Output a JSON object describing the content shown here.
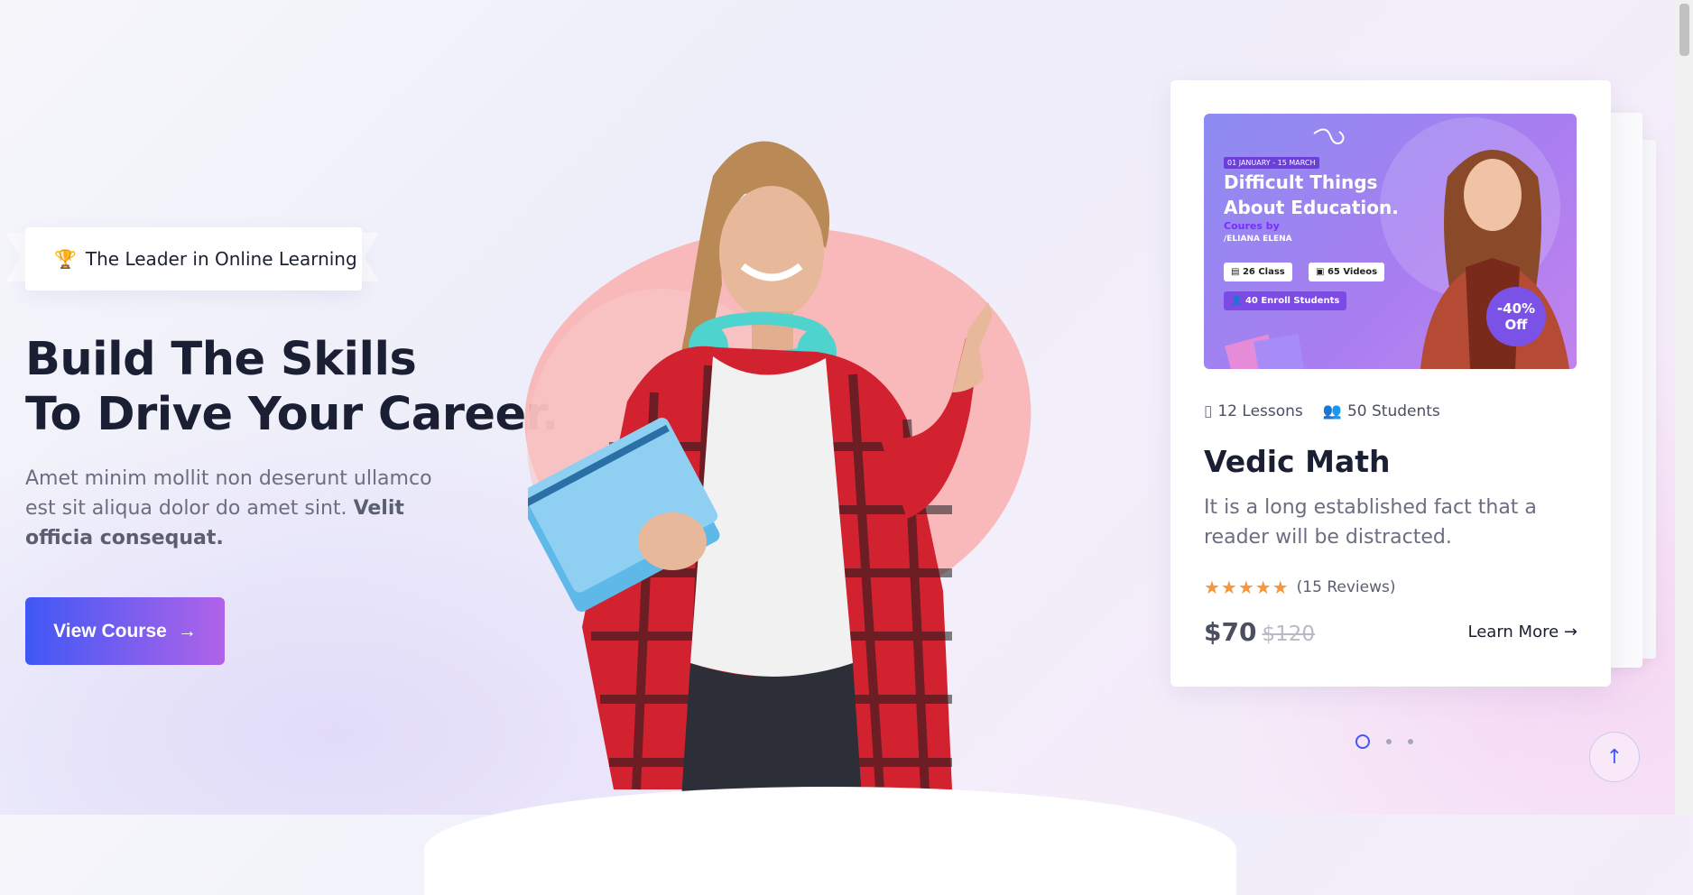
{
  "hero": {
    "badge": {
      "icon": "trophy-icon",
      "text": "The Leader in Online Learning"
    },
    "title_line1": "Build The Skills",
    "title_line2": "To Drive Your Career.",
    "desc_plain": "Amet minim mollit non deserunt ullamco est sit aliqua dolor do amet sint.",
    "desc_bold": "Velit officia consequat.",
    "cta": {
      "label": "View Course",
      "icon": "arrow-right-icon"
    }
  },
  "course_card": {
    "banner": {
      "date": "01 JANUARY - 15 MARCH",
      "title_line1": "Difficult Things",
      "title_line2": "About Education.",
      "by_label": "Coures by",
      "author": "/ELIANA ELENA",
      "chips": [
        "26 Class",
        "65 Videos",
        "40 Enroll Students"
      ],
      "discount_line1": "-40%",
      "discount_line2": "Off"
    },
    "lessons": "12 Lessons",
    "students": "50 Students",
    "title": "Vedic Math",
    "description": "It is a long established fact that a reader will be distracted.",
    "stars": "★★★★★",
    "reviews": "(15 Reviews)",
    "price": "$70",
    "old_price": "$120",
    "learn_more": "Learn More",
    "accent": "#3f58f5"
  },
  "carousel": {
    "active_index": 0,
    "count": 3
  },
  "scroll_top_icon": "arrow-up-icon"
}
